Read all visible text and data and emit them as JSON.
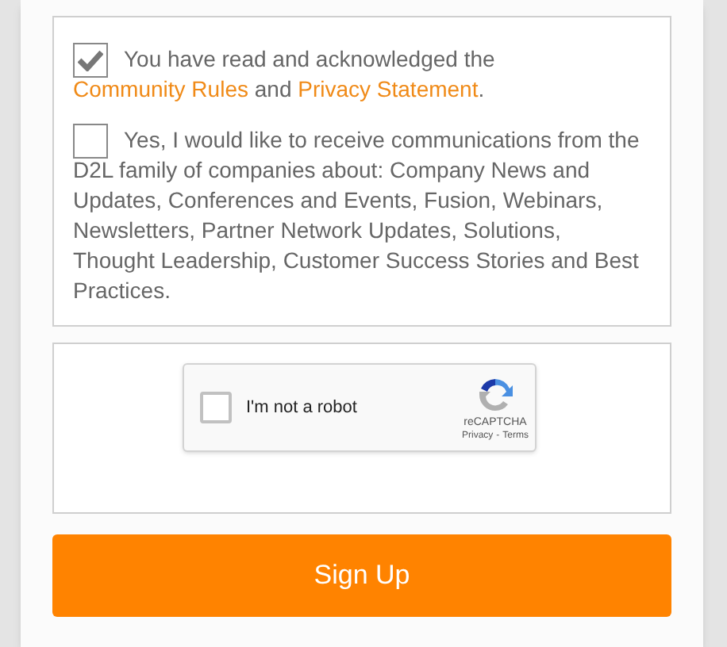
{
  "consents": [
    {
      "checked": true,
      "first_line": "You have read and acknowledged the",
      "rest": [
        {
          "kind": "link",
          "text": "Community Rules"
        },
        {
          "kind": "text",
          "text": " and "
        },
        {
          "kind": "link",
          "text": "Privacy Statement"
        },
        {
          "kind": "text",
          "text": "."
        }
      ]
    },
    {
      "checked": false,
      "first_line": "Yes, I would like to receive communications from the",
      "rest": [
        {
          "kind": "text",
          "text": "D2L family of companies about: Company News and Updates, Conferences and Events, Fusion, Webinars, Newsletters, Partner Network Updates, Solutions, Thought Leadership, Customer Success Stories and Best Practices."
        }
      ]
    }
  ],
  "captcha": {
    "checked": false,
    "label": "I'm not a robot",
    "brand": "reCAPTCHA",
    "privacy": "Privacy",
    "separator": "-",
    "terms": "Terms"
  },
  "submit": {
    "label": "Sign Up"
  }
}
